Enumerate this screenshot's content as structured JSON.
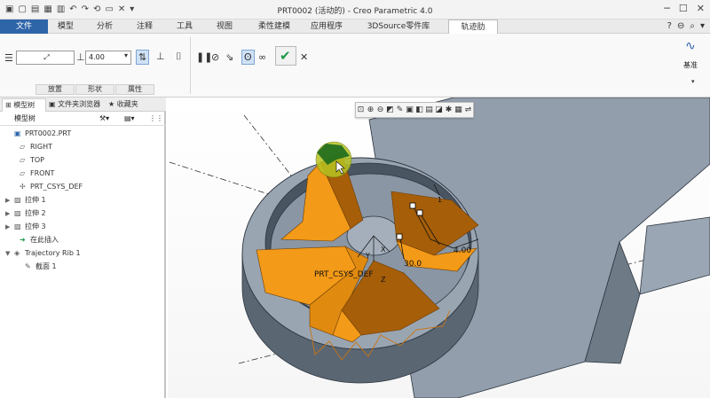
{
  "window": {
    "title": "PRT0002 (活动的) - Creo Parametric 4.0"
  },
  "ribbon_tabs": [
    "文件",
    "模型",
    "分析",
    "注释",
    "工具",
    "视图",
    "柔性建模",
    "应用程序",
    "3DSource零件库",
    "轨迹肋"
  ],
  "ribbon": {
    "thickness_value": "4.00",
    "groups": [
      "放置",
      "形状",
      "属性"
    ],
    "datum_label": "基准"
  },
  "panel": {
    "tabs": [
      "模型树",
      "文件夹浏览器",
      "收藏夹"
    ],
    "tree_title": "模型树",
    "tree": [
      {
        "label": "PRT0002.PRT",
        "icon": "part-icon",
        "expander": "",
        "indent": 0
      },
      {
        "label": "RIGHT",
        "icon": "datum-plane-icon",
        "expander": "",
        "indent": 1
      },
      {
        "label": "TOP",
        "icon": "datum-plane-icon",
        "expander": "",
        "indent": 1
      },
      {
        "label": "FRONT",
        "icon": "datum-plane-icon",
        "expander": "",
        "indent": 1
      },
      {
        "label": "PRT_CSYS_DEF",
        "icon": "csys-icon",
        "expander": "",
        "indent": 1
      },
      {
        "label": "拉伸 1",
        "icon": "extrude-icon",
        "expander": "▶",
        "indent": 0
      },
      {
        "label": "拉伸 2",
        "icon": "extrude-icon",
        "expander": "▶",
        "indent": 0
      },
      {
        "label": "拉伸 3",
        "icon": "extrude-icon",
        "expander": "▶",
        "indent": 0
      },
      {
        "label": "在此插入",
        "icon": "insert-arrow-icon",
        "expander": "",
        "indent": 1
      },
      {
        "label": "Trajectory Rib 1",
        "icon": "trajectory-rib-icon",
        "expander": "▼",
        "indent": 0
      },
      {
        "label": "截面 1",
        "icon": "sketch-icon",
        "expander": "",
        "indent": 2
      }
    ]
  },
  "viewport": {
    "csys_label": "PRT_CSYS_DEF",
    "dim_width": "4.00",
    "dim_draft": "30.0",
    "axis_y": "Y",
    "axis_x": "X",
    "axis_z": "Z",
    "dim_small": "1"
  },
  "colors": {
    "accent_blue": "#2e64a8",
    "rib_orange": "#f39a18",
    "rib_shadow": "#a65e09",
    "body_gray": "#8e9aa8",
    "body_dark": "#4a5562",
    "confirm_green": "#1e9a48"
  }
}
